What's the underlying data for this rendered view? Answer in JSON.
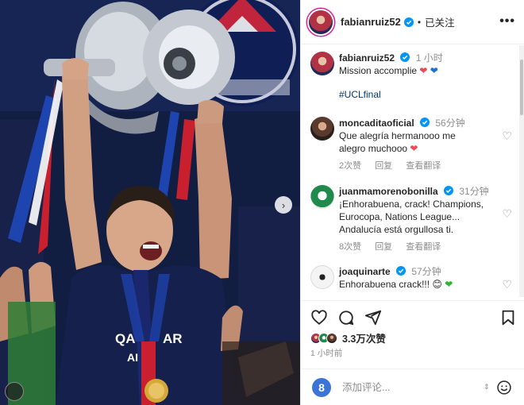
{
  "post": {
    "username": "fabianruiz52",
    "follow_state": "已关注",
    "more_label": "•••",
    "carousel_next": "›",
    "caption": {
      "username": "fabianruiz52",
      "time": "1 小时",
      "text": "Mission accomplie",
      "emojis": [
        "red-heart",
        "blue-heart"
      ],
      "hashtag": "#UCLfinal"
    },
    "comments": [
      {
        "username": "moncaditaoficial",
        "time": "56分钟",
        "text": "Que alegría hermanooo me alegro muchooo",
        "emoji": "red-heart",
        "likes": "2次赞",
        "reply": "回复",
        "translate": "查看翻译"
      },
      {
        "username": "juanmamorenobonilla",
        "time": "31分钟",
        "text": "¡Enhorabuena, crack! Champions, Eurocopa, Nations League... Andalucía está orgullosa ti.",
        "likes": "8次赞",
        "reply": "回复",
        "translate": "查看翻译"
      },
      {
        "username": "joaquinarte",
        "time": "57分钟",
        "text": "Enhorabuena crack!!!",
        "emojis": [
          "smiling-face",
          "green-heart"
        ],
        "likes": "",
        "reply": "",
        "translate": ""
      }
    ],
    "likes_count": "3.3万次赞",
    "posted_time": "1 小时前",
    "composer": {
      "placeholder": "添加评论...",
      "user_initial": "8",
      "resize_mark": "⇕"
    },
    "colors": {
      "verified": "#0095f6",
      "heart": "#ed4956",
      "link": "#00376b",
      "secondary_text": "#8e8e8e"
    }
  }
}
